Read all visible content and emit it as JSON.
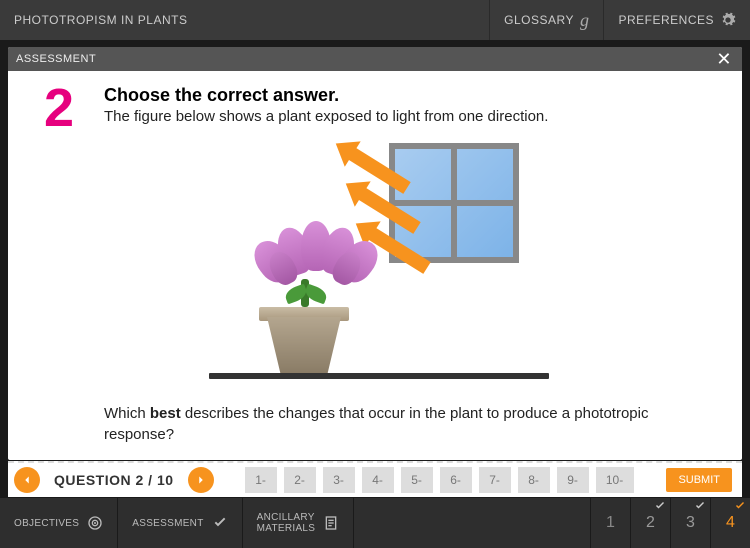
{
  "header": {
    "title": "PHOTOTROPISM IN PLANTS",
    "glossary": "GLOSSARY",
    "preferences": "PREFERENCES"
  },
  "panel": {
    "title": "ASSESSMENT"
  },
  "question": {
    "number": "2",
    "title": "Choose the correct answer.",
    "desc": "The figure below shows a plant exposed to light from one direction.",
    "prompt_pre": "Which ",
    "prompt_bold": "best",
    "prompt_post": " describes the changes that occur in the plant to produce a phototropic response?"
  },
  "nav": {
    "label": "QUESTION 2 / 10",
    "pages": [
      "1-",
      "2-",
      "3-",
      "4-",
      "5-",
      "6-",
      "7-",
      "8-",
      "9-",
      "10-"
    ],
    "submit": "SUBMIT"
  },
  "bottom": {
    "objectives": "OBJECTIVES",
    "assessment": "ASSESSMENT",
    "ancillary1": "ANCILLARY",
    "ancillary2": "MATERIALS",
    "pages": [
      "1",
      "2",
      "3",
      "4"
    ]
  }
}
